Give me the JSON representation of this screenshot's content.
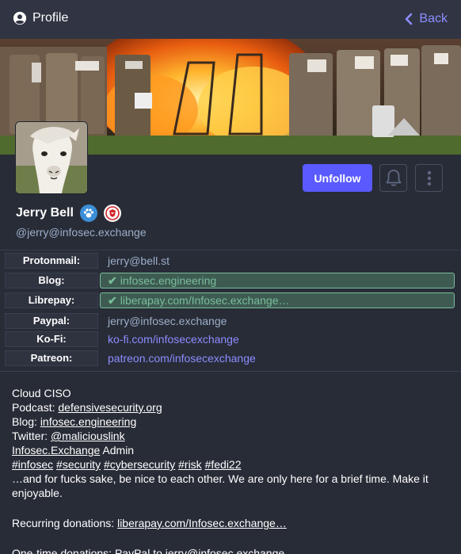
{
  "header": {
    "title": "Profile",
    "back_label": "Back"
  },
  "profile": {
    "display_name": "Jerry Bell",
    "handle": "@jerry@infosec.exchange",
    "unfollow_label": "Unfollow"
  },
  "fields": [
    {
      "label": "Protonmail:",
      "value": "jerry@bell.st"
    },
    {
      "label": "Blog:",
      "value": "infosec.engineering",
      "verified": true
    },
    {
      "label": "Librepay:",
      "value": "liberapay.com/Infosec.exchange…",
      "verified": true
    },
    {
      "label": "Paypal:",
      "value": "jerry@infosec.exchange"
    },
    {
      "label": "Ko-Fi:",
      "value": "ko-fi.com/infosecexchange"
    },
    {
      "label": "Patreon:",
      "value": "patreon.com/infosecexchange"
    }
  ],
  "bio": {
    "line1": "Cloud CISO",
    "podcast_prefix": "Podcast: ",
    "podcast_link": "defensivesecurity.org",
    "blog_prefix": "Blog: ",
    "blog_link": "infosec.engineering",
    "twitter_prefix": "Twitter: ",
    "twitter_link": "@maliciouslink",
    "admin_link": "Infosec.Exchange",
    "admin_suffix": " Admin",
    "hashtags": [
      "#infosec",
      "#security",
      "#cybersecurity",
      "#risk",
      "#fedi22"
    ],
    "motto": "…and for fucks sake, be nice to each other. We are only here for a brief time. Make it enjoyable.",
    "donation_prefix": "Recurring donations: ",
    "donation_link": "liberapay.com/Infosec.exchange…",
    "onetime": "One-time donations: PayPal to jerry@infosec.exchange"
  },
  "colors": {
    "accent": "#595aff",
    "link": "#8c8dff",
    "verified": "#79bd9a",
    "background": "#282c37"
  },
  "icons": [
    "user-circle-icon",
    "chevron-left-icon",
    "bell-icon",
    "ellipsis-vertical-icon",
    "paw-badge-icon",
    "shield-badge-icon",
    "checkmark-icon"
  ]
}
